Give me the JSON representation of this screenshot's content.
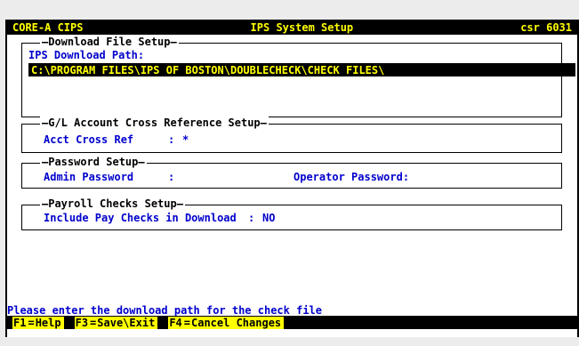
{
  "titlebar": {
    "left": "CORE-A CIPS",
    "center": "IPS System Setup",
    "right": "csr 6031"
  },
  "download": {
    "legend": "Download File Setup",
    "path_label": "IPS Download Path:",
    "path_value": "C:\\PROGRAM FILES\\IPS OF BOSTON\\DOUBLECHECK\\CHECK FILES\\"
  },
  "gl": {
    "legend": "G/L Account Cross Reference Setup",
    "acct_label": "Acct Cross Ref",
    "acct_colon": ":",
    "acct_value": "*"
  },
  "password": {
    "legend": "Password Setup",
    "admin_label": "Admin Password",
    "admin_colon": ":",
    "operator_label": "Operator Password:"
  },
  "payroll": {
    "legend": "Payroll Checks Setup",
    "include_label": "Include Pay Checks in Download",
    "include_colon": ":",
    "include_value": "NO"
  },
  "status": "Please enter the download path for the check file",
  "fkeys": [
    {
      "key": "F1",
      "sep": "=",
      "label": "Help"
    },
    {
      "key": "F3",
      "sep": "=",
      "label": "Save\\Exit"
    },
    {
      "key": "F4",
      "sep": "=",
      "label": "Cancel Changes"
    }
  ]
}
